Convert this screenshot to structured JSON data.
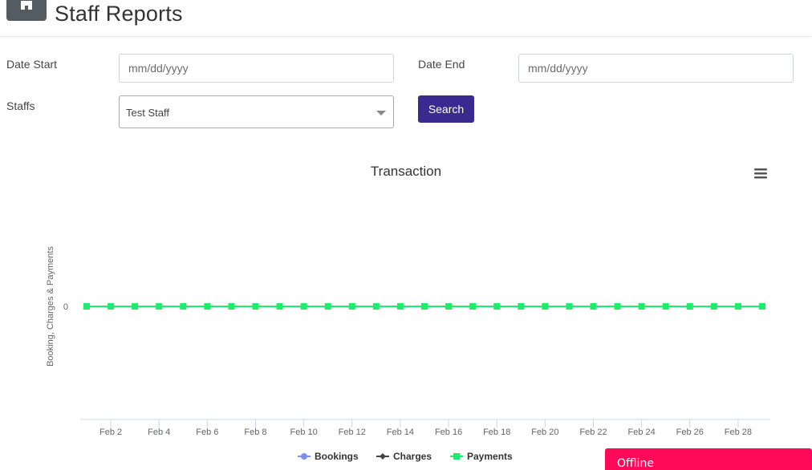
{
  "header": {
    "title": "Staff Reports",
    "home_icon": "home-icon"
  },
  "filters": {
    "date_start_label": "Date Start",
    "date_start_placeholder": "mm/dd/yyyy",
    "date_end_label": "Date End",
    "date_end_placeholder": "mm/dd/yyyy",
    "staffs_label": "Staffs",
    "staffs_value": "Test Staff",
    "search_label": "Search"
  },
  "chart_data": {
    "type": "line",
    "title": "Transaction",
    "ylabel": "Booking, Charges & Payments",
    "xlabel": "",
    "x": [
      "Feb 1",
      "Feb 2",
      "Feb 3",
      "Feb 4",
      "Feb 5",
      "Feb 6",
      "Feb 7",
      "Feb 8",
      "Feb 9",
      "Feb 10",
      "Feb 11",
      "Feb 12",
      "Feb 13",
      "Feb 14",
      "Feb 15",
      "Feb 16",
      "Feb 17",
      "Feb 18",
      "Feb 19",
      "Feb 20",
      "Feb 21",
      "Feb 22",
      "Feb 23",
      "Feb 24",
      "Feb 25",
      "Feb 26",
      "Feb 27",
      "Feb 28",
      "Feb 29"
    ],
    "x_tick_labels": [
      "Feb 2",
      "Feb 4",
      "Feb 6",
      "Feb 8",
      "Feb 10",
      "Feb 12",
      "Feb 14",
      "Feb 16",
      "Feb 18",
      "Feb 20",
      "Feb 22",
      "Feb 24",
      "Feb 26",
      "Feb 28"
    ],
    "y_tick_labels": [
      "0"
    ],
    "series": [
      {
        "name": "Bookings",
        "color": "#7b8ff7",
        "marker": "circle",
        "values": [
          0,
          0,
          0,
          0,
          0,
          0,
          0,
          0,
          0,
          0,
          0,
          0,
          0,
          0,
          0,
          0,
          0,
          0,
          0,
          0,
          0,
          0,
          0,
          0,
          0,
          0,
          0,
          0,
          0
        ]
      },
      {
        "name": "Charges",
        "color": "#434348",
        "marker": "diamond",
        "values": [
          0,
          0,
          0,
          0,
          0,
          0,
          0,
          0,
          0,
          0,
          0,
          0,
          0,
          0,
          0,
          0,
          0,
          0,
          0,
          0,
          0,
          0,
          0,
          0,
          0,
          0,
          0,
          0,
          0
        ]
      },
      {
        "name": "Payments",
        "color": "#1aee6a",
        "marker": "square",
        "values": [
          0,
          0,
          0,
          0,
          0,
          0,
          0,
          0,
          0,
          0,
          0,
          0,
          0,
          0,
          0,
          0,
          0,
          0,
          0,
          0,
          0,
          0,
          0,
          0,
          0,
          0,
          0,
          0,
          0
        ]
      }
    ],
    "legend": "bottom-center",
    "grid": false,
    "menu_icon": "hamburger-menu-icon"
  },
  "chat": {
    "status": "Offline"
  }
}
